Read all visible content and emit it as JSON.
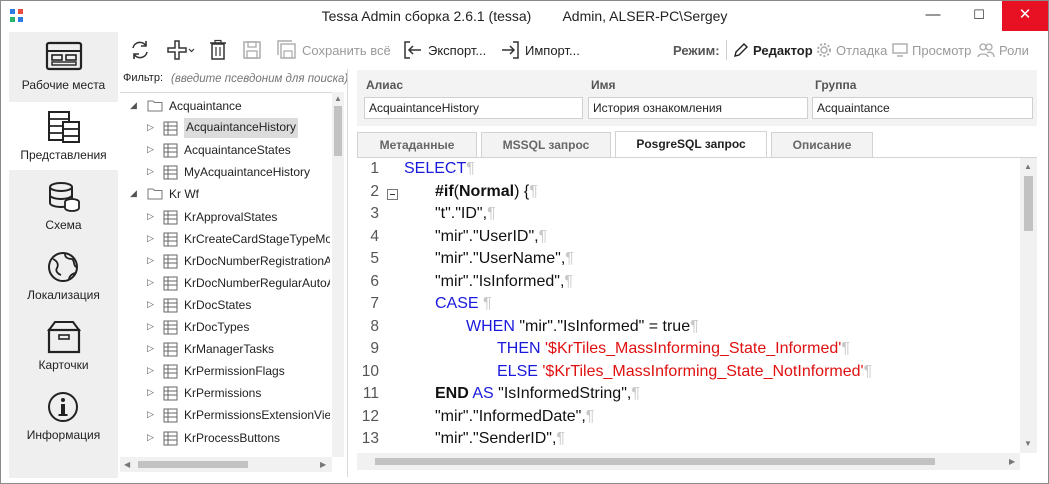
{
  "window": {
    "title": "Tessa Admin сборка 2.6.1 (tessa)",
    "user": "Admin, ALSER-PC\\Sergey",
    "minimize": "—",
    "maximize": "☐",
    "close": "✕"
  },
  "nav": [
    {
      "label": "Рабочие места",
      "icon": "workplaces-icon"
    },
    {
      "label": "Представления",
      "icon": "views-icon"
    },
    {
      "label": "Схема",
      "icon": "schema-icon"
    },
    {
      "label": "Локализация",
      "icon": "globe-icon"
    },
    {
      "label": "Карточки",
      "icon": "cards-icon"
    },
    {
      "label": "Информация",
      "icon": "info-icon"
    }
  ],
  "toolbar": {
    "save_all": "Сохранить всё",
    "export": "Экспорт...",
    "import": "Импорт...",
    "mode_label": "Режим:",
    "modes": [
      "Редактор",
      "Отладка",
      "Просмотр",
      "Роли"
    ]
  },
  "filter": {
    "label": "Фильтр:",
    "placeholder": "(введите псевдоним для поиска)"
  },
  "tree": {
    "groups": [
      {
        "name": "Acquaintance",
        "items": [
          "AcquaintanceHistory",
          "AcquaintanceStates",
          "MyAcquaintanceHistory"
        ]
      },
      {
        "name": "Kr Wf",
        "items": [
          "KrApprovalStates",
          "KrCreateCardStageTypeMode",
          "KrDocNumberRegistrationA",
          "KrDocNumberRegularAutoA",
          "KrDocStates",
          "KrDocTypes",
          "KrManagerTasks",
          "KrPermissionFlags",
          "KrPermissions",
          "KrPermissionsExtensionView",
          "KrProcessButtons"
        ]
      }
    ],
    "selected": "AcquaintanceHistory"
  },
  "details": {
    "alias_label": "Алиас",
    "alias_value": "AcquaintanceHistory",
    "name_label": "Имя",
    "name_value": "История ознакомления",
    "group_label": "Группа",
    "group_value": "Acquaintance"
  },
  "tabs": [
    "Метаданные",
    "MSSQL запрос",
    "PosgreSQL запрос",
    "Описание"
  ],
  "active_tab": "PosgreSQL запрос",
  "editor": {
    "pilcrow": "¶",
    "lines": [
      {
        "n": "1",
        "indent": 0,
        "parts": [
          {
            "t": "kw",
            "v": "SELECT"
          }
        ]
      },
      {
        "n": "2",
        "indent": 1,
        "fold": true,
        "parts": [
          {
            "t": "kwb",
            "v": "#if"
          },
          {
            "t": "txt",
            "v": "("
          },
          {
            "t": "kwb",
            "v": "Normal"
          },
          {
            "t": "txt",
            "v": ") {"
          }
        ]
      },
      {
        "n": "3",
        "indent": 1,
        "parts": [
          {
            "t": "txt",
            "v": "\"t\".\"ID\","
          }
        ]
      },
      {
        "n": "4",
        "indent": 1,
        "parts": [
          {
            "t": "txt",
            "v": "\"mir\".\"UserID\","
          }
        ]
      },
      {
        "n": "5",
        "indent": 1,
        "parts": [
          {
            "t": "txt",
            "v": "\"mir\".\"UserName\","
          }
        ]
      },
      {
        "n": "6",
        "indent": 1,
        "parts": [
          {
            "t": "txt",
            "v": "\"mir\".\"IsInformed\","
          }
        ]
      },
      {
        "n": "7",
        "indent": 1,
        "parts": [
          {
            "t": "kw",
            "v": "CASE "
          }
        ]
      },
      {
        "n": "8",
        "indent": 2,
        "parts": [
          {
            "t": "kw",
            "v": "WHEN "
          },
          {
            "t": "txt",
            "v": "\"mir\".\"IsInformed\" = true"
          }
        ]
      },
      {
        "n": "9",
        "indent": 3,
        "parts": [
          {
            "t": "kw",
            "v": "THEN "
          },
          {
            "t": "str",
            "v": "'$KrTiles_MassInforming_State_Informed'"
          }
        ]
      },
      {
        "n": "10",
        "indent": 3,
        "parts": [
          {
            "t": "kw",
            "v": "ELSE "
          },
          {
            "t": "str",
            "v": "'$KrTiles_MassInforming_State_NotInformed'"
          }
        ]
      },
      {
        "n": "11",
        "indent": 1,
        "parts": [
          {
            "t": "kwb",
            "v": "END"
          },
          {
            "t": "kw",
            "v": " AS "
          },
          {
            "t": "txt",
            "v": "\"IsInformedString\","
          }
        ]
      },
      {
        "n": "12",
        "indent": 1,
        "parts": [
          {
            "t": "txt",
            "v": "\"mir\".\"InformedDate\","
          }
        ]
      },
      {
        "n": "13",
        "indent": 1,
        "parts": [
          {
            "t": "txt",
            "v": "\"mir\".\"SenderID\","
          }
        ]
      }
    ]
  },
  "colors": {
    "keyword": "#1a1adc",
    "string": "#e01010",
    "close_button": "#e81123",
    "nav_bg": "#efefef"
  }
}
